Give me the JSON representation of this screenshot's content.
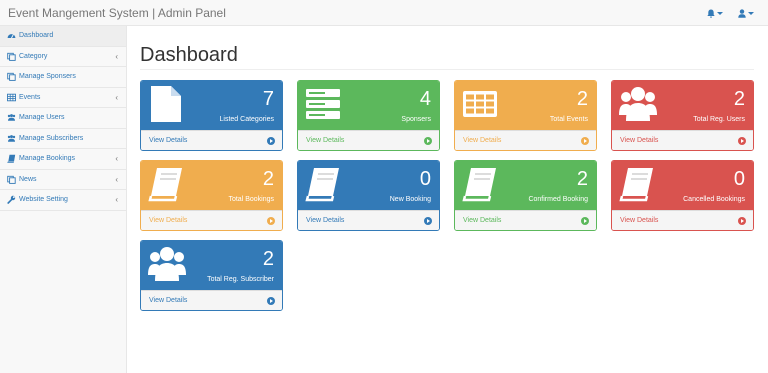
{
  "header": {
    "brand": "Event Mangement System | Admin Panel",
    "accent": "#337ab7"
  },
  "sidebar": {
    "items": [
      {
        "label": "Dashboard",
        "icon": "dashboard-icon",
        "has_submenu": false,
        "active": true
      },
      {
        "label": "Category",
        "icon": "folder-icon",
        "has_submenu": true,
        "active": false
      },
      {
        "label": "Manage Sponsers",
        "icon": "folder-icon",
        "has_submenu": false,
        "active": false
      },
      {
        "label": "Events",
        "icon": "table-icon",
        "has_submenu": true,
        "active": false
      },
      {
        "label": "Manage Users",
        "icon": "users-icon",
        "has_submenu": false,
        "active": false
      },
      {
        "label": "Manage Subscribers",
        "icon": "users-icon",
        "has_submenu": false,
        "active": false
      },
      {
        "label": "Manage Bookings",
        "icon": "book-icon",
        "has_submenu": true,
        "active": false
      },
      {
        "label": "News",
        "icon": "folder-icon",
        "has_submenu": true,
        "active": false
      },
      {
        "label": "Website Setting",
        "icon": "wrench-icon",
        "has_submenu": true,
        "active": false
      }
    ],
    "chevron": "‹"
  },
  "main": {
    "title": "Dashboard",
    "cards": [
      {
        "count": "7",
        "label": "Listed Categories",
        "link": "View Details",
        "color": "#337ab7",
        "icon": "file-icon"
      },
      {
        "count": "4",
        "label": "Sponsers",
        "link": "View Details",
        "color": "#5cb85c",
        "icon": "server-icon"
      },
      {
        "count": "2",
        "label": "Total Events",
        "link": "View Details",
        "color": "#f0ad4e",
        "icon": "table-icon"
      },
      {
        "count": "2",
        "label": "Total Reg. Users",
        "link": "View Details",
        "color": "#d9534f",
        "icon": "users-icon"
      },
      {
        "count": "2",
        "label": "Total Bookings",
        "link": "View Details",
        "color": "#f0ad4e",
        "icon": "book-icon"
      },
      {
        "count": "0",
        "label": "New Booking",
        "link": "View Details",
        "color": "#337ab7",
        "icon": "book-icon"
      },
      {
        "count": "2",
        "label": "Confirmed Booking",
        "link": "View Details",
        "color": "#5cb85c",
        "icon": "book-icon"
      },
      {
        "count": "0",
        "label": "Cancelled Bookings",
        "link": "View Details",
        "color": "#d9534f",
        "icon": "book-icon"
      },
      {
        "count": "2",
        "label": "Total Reg. Subscriber",
        "link": "View Details",
        "color": "#337ab7",
        "icon": "users-icon"
      }
    ]
  }
}
